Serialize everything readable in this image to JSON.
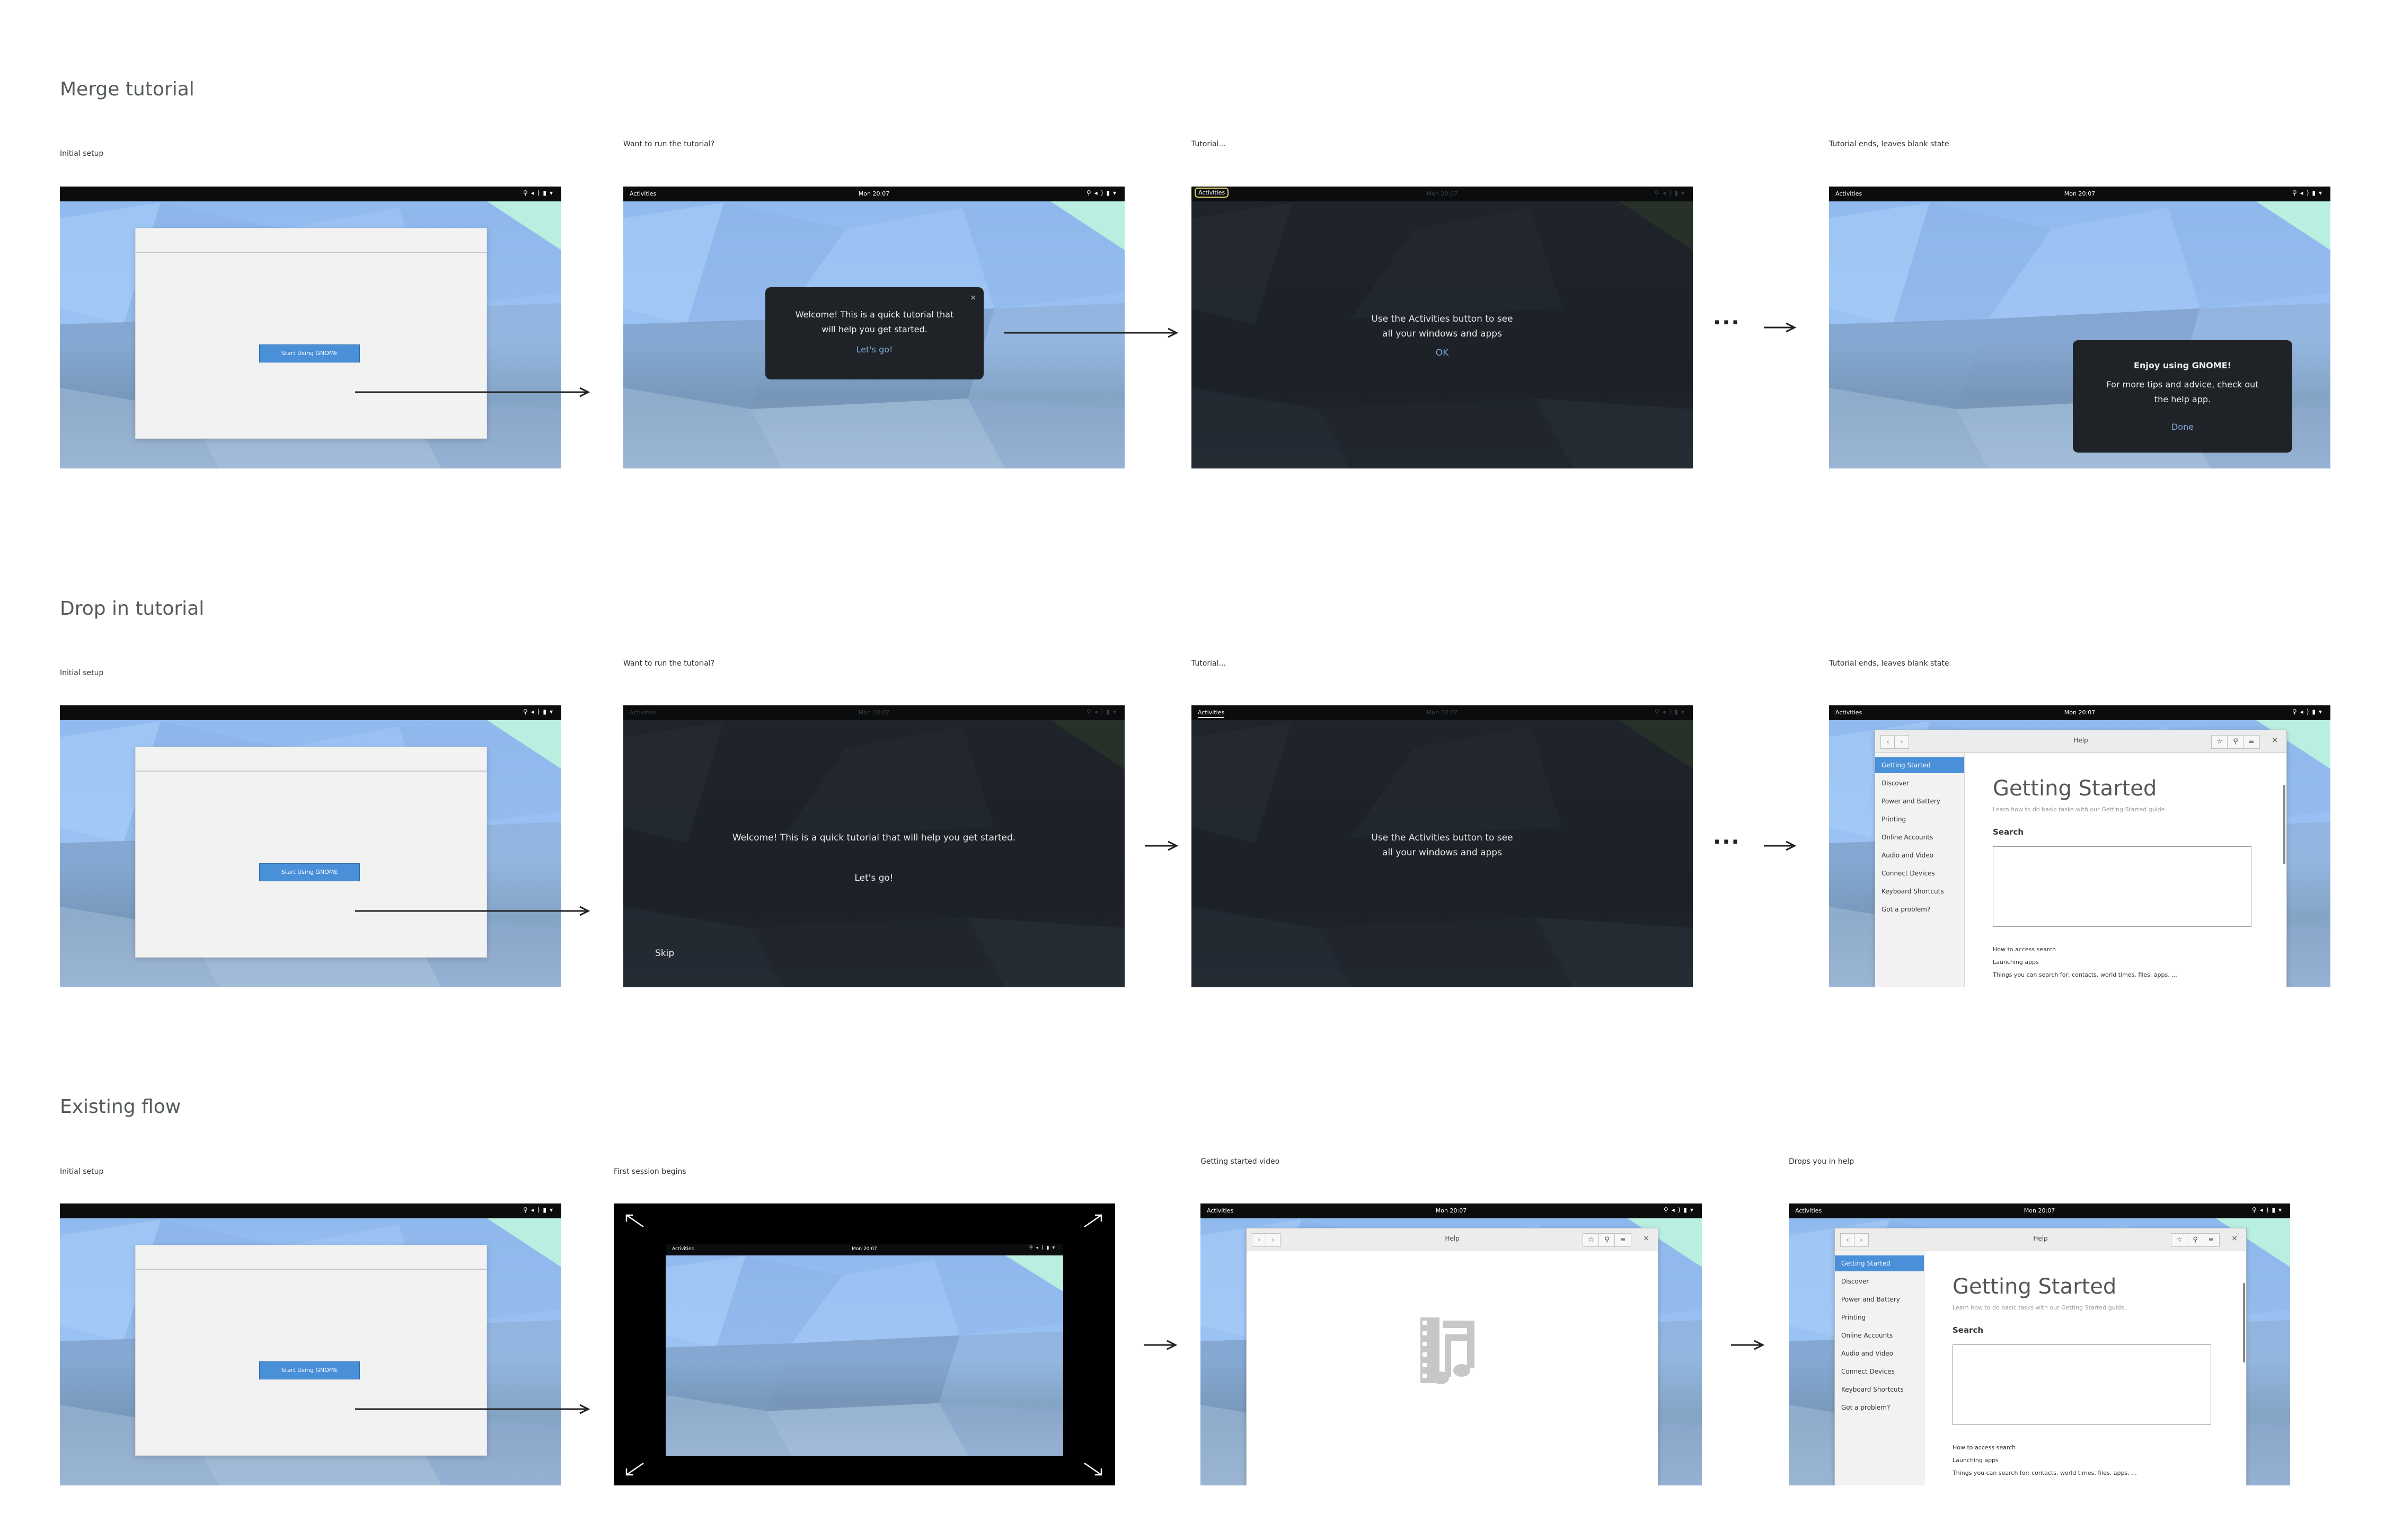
{
  "sections": [
    {
      "title": "Merge tutorial",
      "captions": [
        "Initial setup",
        "Want to run the tutorial?",
        "Tutorial...",
        "Tutorial ends, leaves blank state"
      ]
    },
    {
      "title": "Drop in tutorial",
      "captions": [
        "Initial setup",
        "Want to run the tutorial?",
        "Tutorial...",
        "Tutorial ends, leaves blank state"
      ]
    },
    {
      "title": "Existing flow",
      "captions": [
        "Initial setup",
        "First session begins",
        "Getting started video",
        "Drops you in help"
      ]
    }
  ],
  "topbar": {
    "activities": "Activities",
    "clock": "Mon 20:07",
    "tray": "⚲◂)▮▾"
  },
  "setup": {
    "button": "Start Using GNOME"
  },
  "merge": {
    "welcome_line1": "Welcome! This is a quick tutorial that",
    "welcome_line2": "will help you get started.",
    "welcome_link": "Let's go!",
    "close": "×",
    "act_line1": "Use the Activities button to see",
    "act_line2": "all your windows and apps",
    "act_ok": "OK",
    "end_title": "Enjoy using GNOME!",
    "end_line1": "For more tips and advice, check out",
    "end_line2": "the help app.",
    "end_done": "Done"
  },
  "drop": {
    "welcome": "Welcome! This is a quick tutorial that will help you get started.",
    "lets_go": "Let's go!",
    "skip": "Skip",
    "act_line1": "Use the Activities button to see",
    "act_line2": "all your windows and apps"
  },
  "ellipsis": "...",
  "help": {
    "window_title": "Help",
    "sidebar": [
      "Getting Started",
      "Discover",
      "Power and Battery",
      "Printing",
      "Online Accounts",
      "Audio and Video",
      "Connect Devices",
      "Keyboard Shortcuts",
      "Got a problem?"
    ],
    "heading": "Getting Started",
    "subtitle": "Learn how to do basic tasks with our Getting Started guide.",
    "search_label": "Search",
    "links": [
      "How to access search",
      "Launching apps",
      "Things you can search for: contacts, world times, files, apps, ..."
    ]
  },
  "icons": {
    "video": "film-music-icon"
  }
}
